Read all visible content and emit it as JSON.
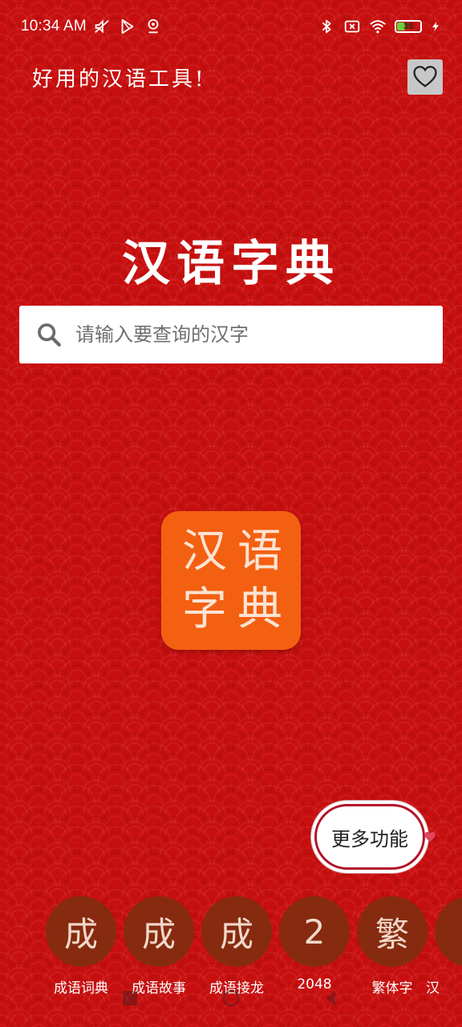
{
  "status_bar": {
    "time": "10:34 AM",
    "battery_level": "35",
    "icons_left": [
      "mute-icon",
      "play-store-icon",
      "location-icon"
    ],
    "icons_right": [
      "bluetooth-icon",
      "sim-off-icon",
      "wifi-icon",
      "battery-icon",
      "charging-icon"
    ]
  },
  "header": {
    "slogan": "好用的汉语工具!",
    "favorite_icon": "heart-outline-icon"
  },
  "main": {
    "title": "汉语字典",
    "search": {
      "placeholder": "请输入要查询的汉字",
      "value": ""
    },
    "logo": {
      "chars": [
        "汉",
        "语",
        "字",
        "典"
      ]
    },
    "more_button": "更多功能"
  },
  "tools": [
    {
      "glyph": "成",
      "label": "成语词典"
    },
    {
      "glyph": "成",
      "label": "成语故事"
    },
    {
      "glyph": "成",
      "label": "成语接龙"
    },
    {
      "glyph": "2",
      "label": "2048"
    },
    {
      "glyph": "繁",
      "label": "繁体字"
    },
    {
      "glyph": "",
      "label": "汉"
    }
  ],
  "colors": {
    "background": "#c80f0f",
    "logo": "#f36011",
    "tool_circle": "#862b0f"
  }
}
